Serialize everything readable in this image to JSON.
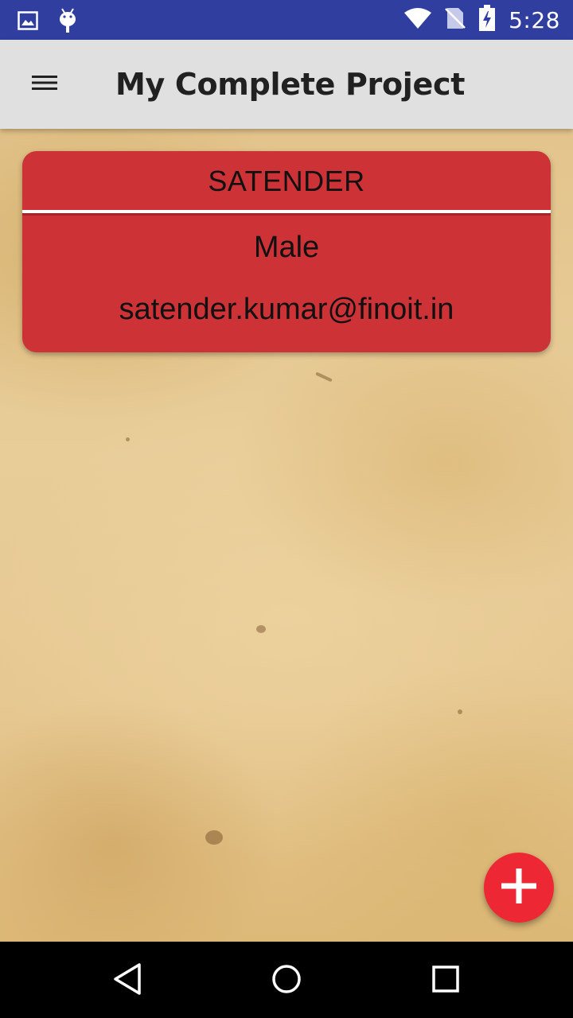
{
  "status_bar": {
    "time": "5:28",
    "icons": [
      "image-notification-icon",
      "android-debug-icon",
      "wifi-icon",
      "no-sim-icon",
      "battery-charging-icon"
    ]
  },
  "app_bar": {
    "title": "My Complete Project",
    "menu_icon": "hamburger-menu-icon",
    "background": "#e0e0e0"
  },
  "card": {
    "name": "SATENDER",
    "gender": "Male",
    "email": "satender.kumar@finoit.in",
    "color": "#cd3237"
  },
  "fab": {
    "icon": "plus-icon",
    "color": "#ed2733"
  },
  "nav_bar": {
    "buttons": [
      "back-icon",
      "home-icon",
      "recents-icon"
    ]
  }
}
